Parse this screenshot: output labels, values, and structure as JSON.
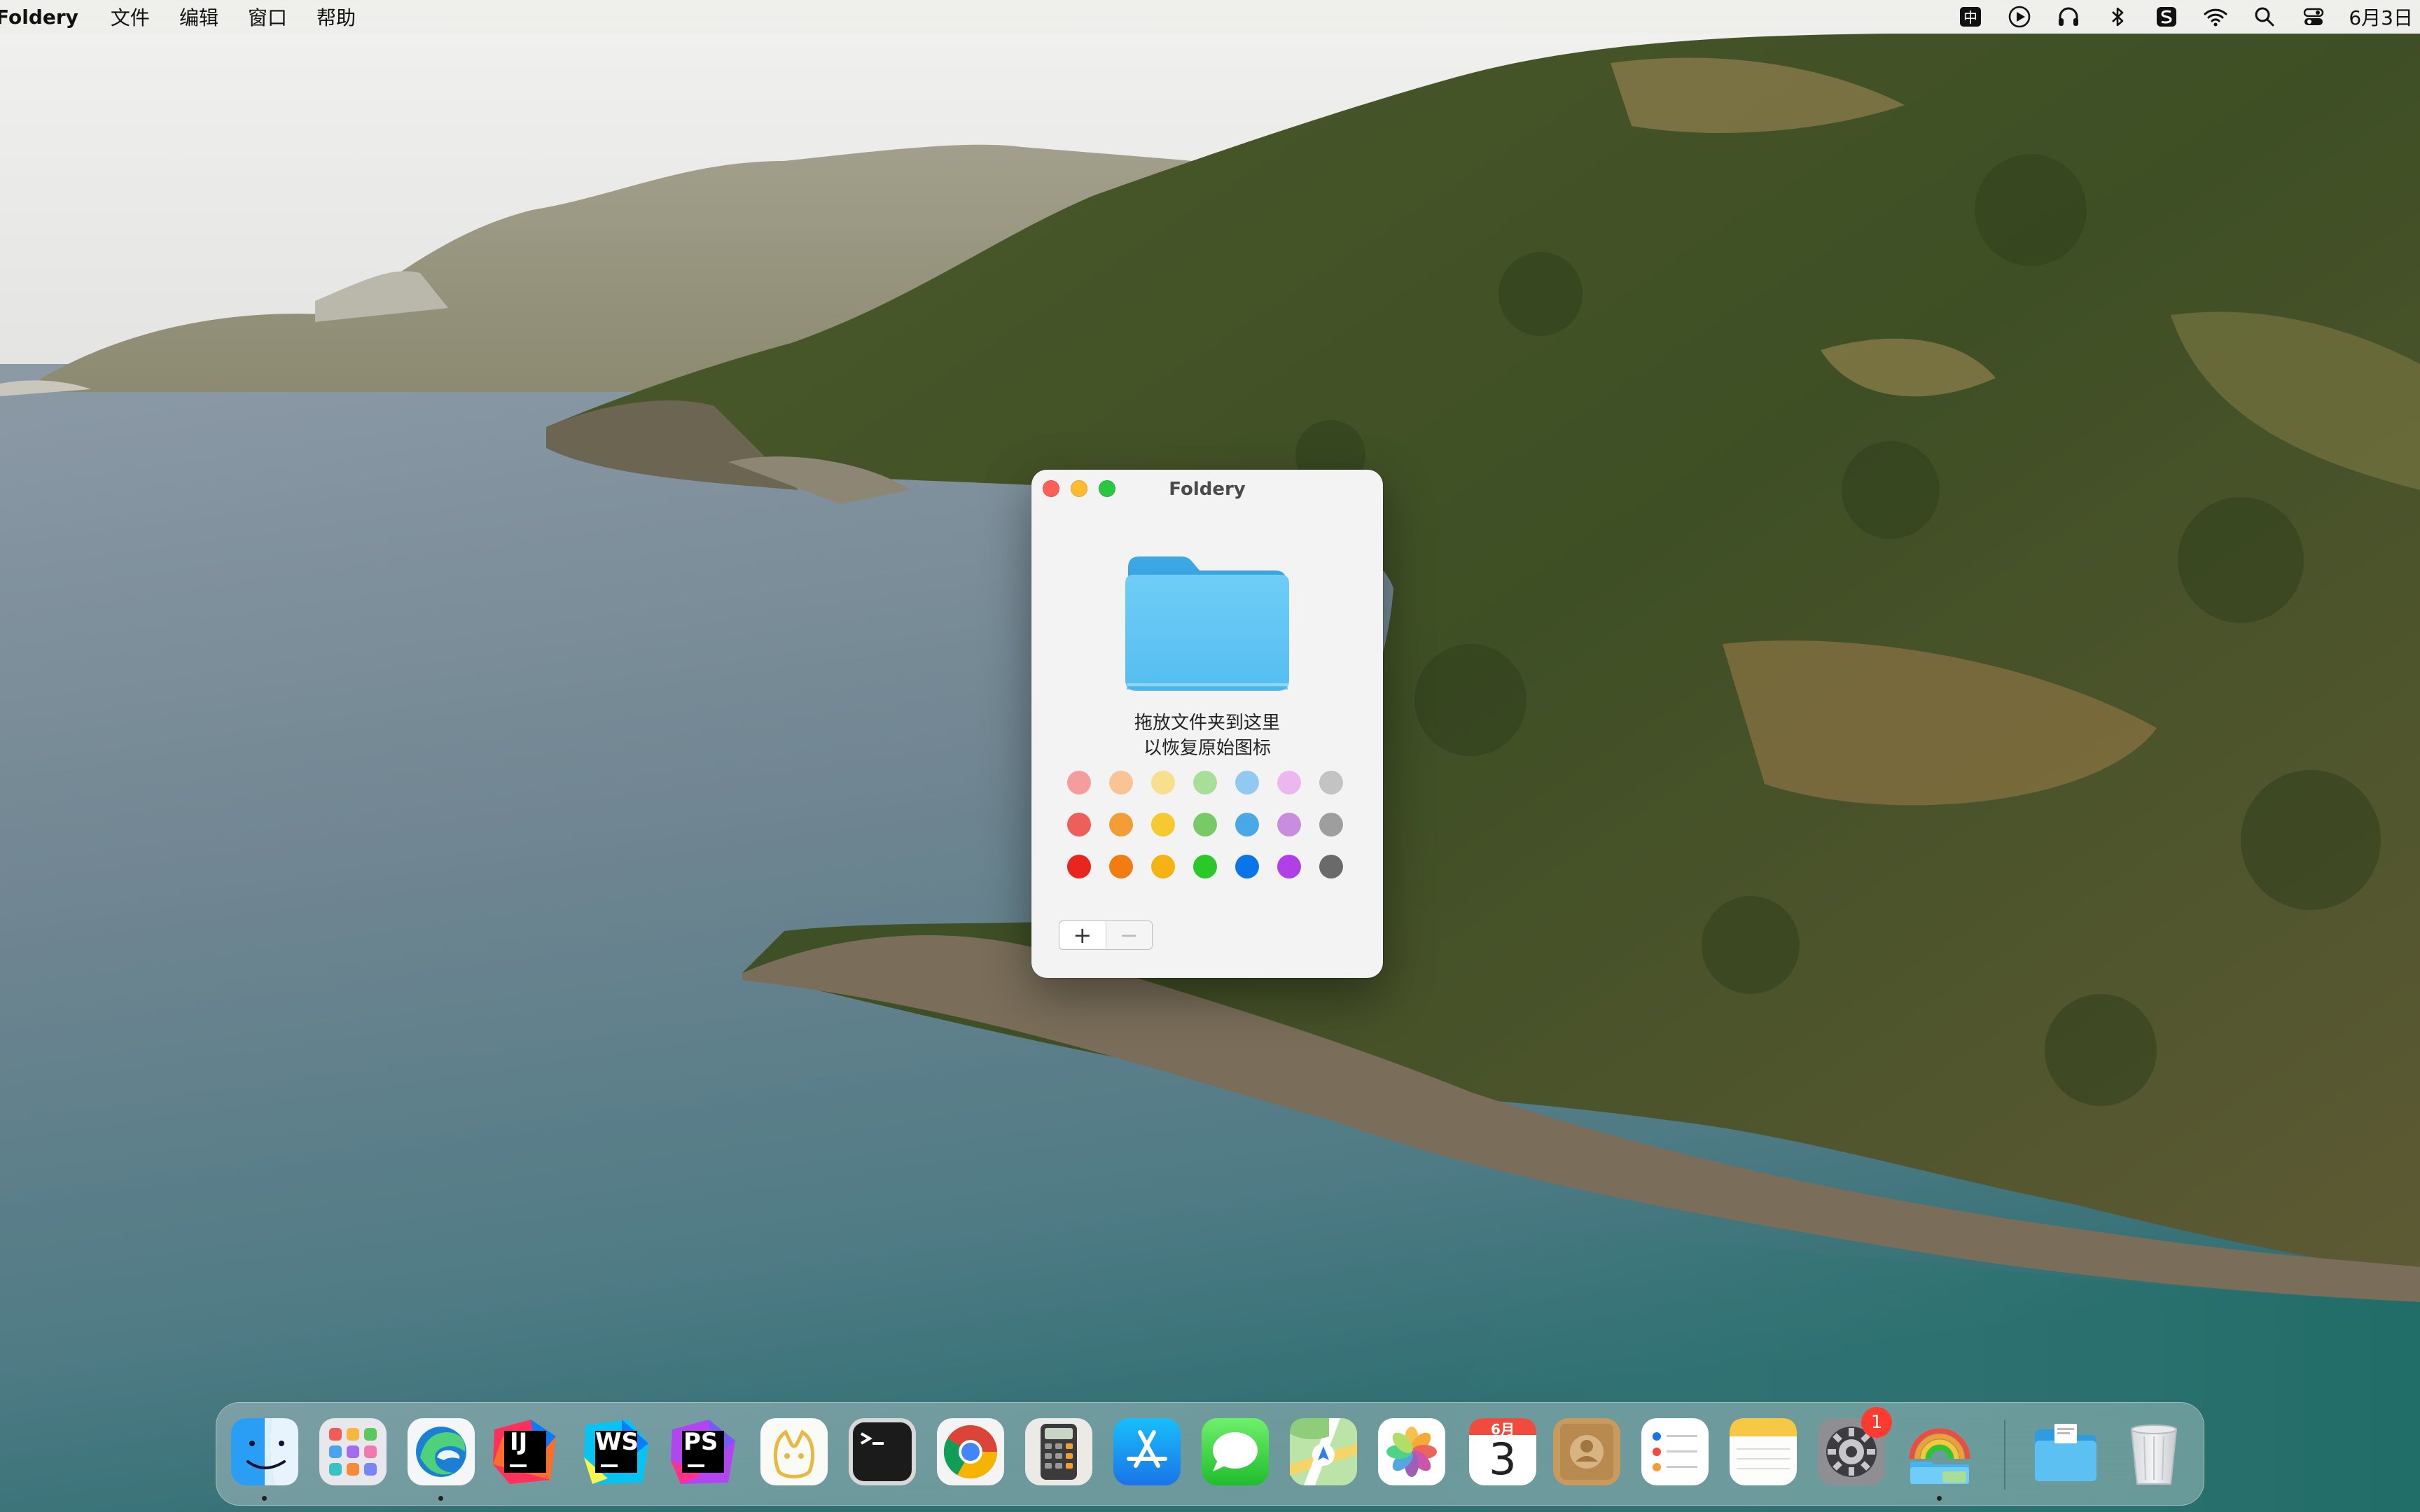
{
  "menubar": {
    "app_name": "Foldery",
    "menus": [
      "文件",
      "编辑",
      "窗口",
      "帮助"
    ],
    "input_method": "中",
    "clock": "6月3日"
  },
  "window": {
    "title": "Foldery",
    "drop_hint_line1": "拖放文件夹到这里",
    "drop_hint_line2": "以恢复原始图标",
    "add_button": "+",
    "remove_button": "−",
    "swatch_colors": [
      [
        "#f79c9c",
        "#f8c494",
        "#f8df8c",
        "#a8df98",
        "#92c9f0",
        "#ecb6ee",
        "#c3c3c3"
      ],
      [
        "#ee5f5a",
        "#f29d35",
        "#f6c92f",
        "#78ca66",
        "#4aa8e6",
        "#c98de0",
        "#9e9e9e"
      ],
      [
        "#e8261d",
        "#f17c12",
        "#f5b313",
        "#2bc829",
        "#0b74e8",
        "#b040e6",
        "#6a6a6a"
      ]
    ]
  },
  "dock": {
    "apps": [
      "Finder",
      "Launchpad",
      "Microsoft Edge",
      "IntelliJ IDEA",
      "WebStorm",
      "PhpStorm",
      "Navicat",
      "Terminal",
      "Google Chrome",
      "Calculator",
      "App Store",
      "Messages",
      "Maps",
      "Photos",
      "Calendar",
      "Contacts",
      "Reminders",
      "Notes",
      "System Settings",
      "Foldery",
      "Downloads",
      "Trash"
    ],
    "ide_labels": {
      "intellij": "IJ",
      "webstorm": "WS",
      "phpstorm": "PS"
    },
    "calendar_month": "6月",
    "calendar_day": "3",
    "settings_badge": "1"
  },
  "colors": {
    "folder_blue": "#5cc1f2",
    "accent": "#0b74e8"
  }
}
